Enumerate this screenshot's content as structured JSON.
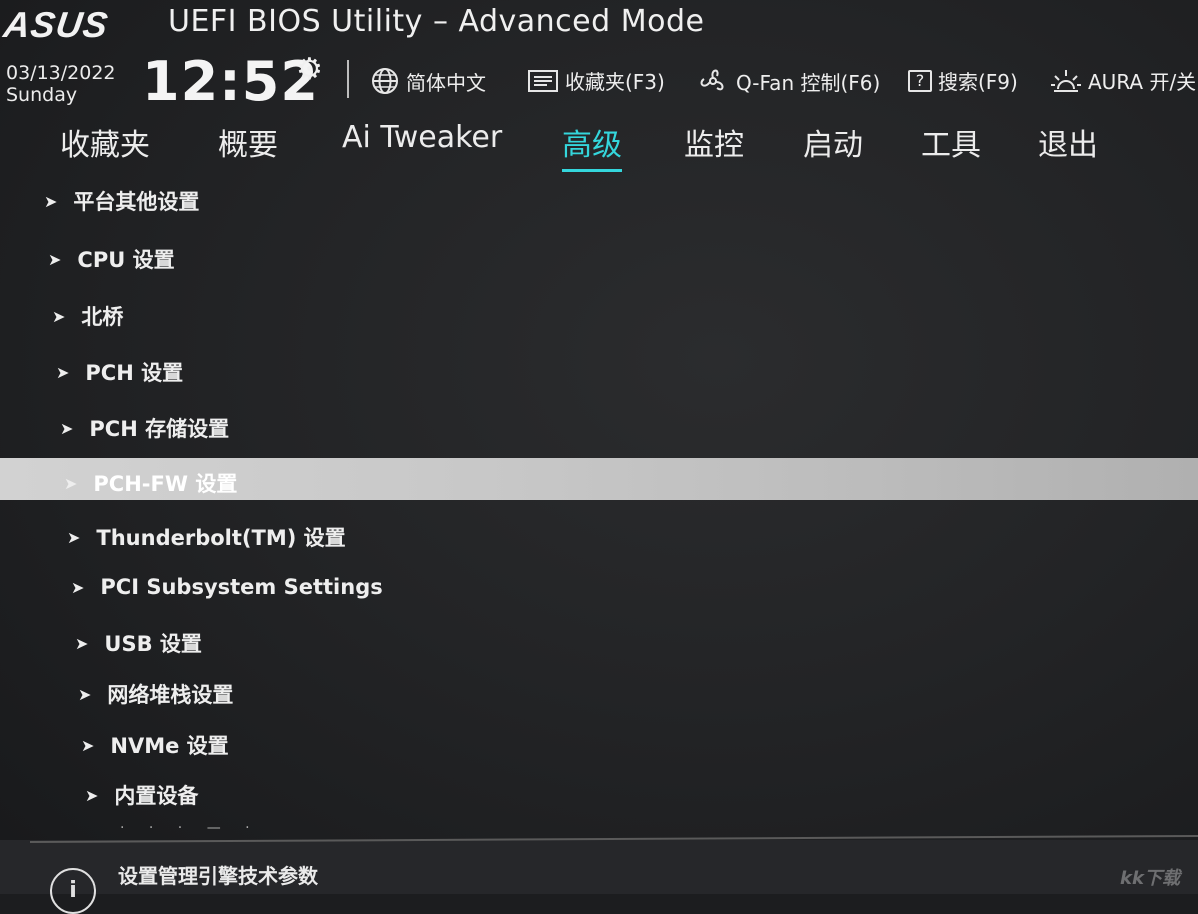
{
  "header": {
    "logo": "ASUS",
    "title": "UEFI BIOS Utility – Advanced Mode",
    "date": "03/13/2022",
    "weekday": "Sunday",
    "time": "12:52",
    "tools": {
      "language": "简体中文",
      "favorites": "收藏夹(F3)",
      "qfan": "Q-Fan 控制(F6)",
      "search": "搜索(F9)",
      "aura": "AURA 开/关"
    }
  },
  "tabs": [
    {
      "label": "收藏夹"
    },
    {
      "label": "概要"
    },
    {
      "label": "Ai Tweaker"
    },
    {
      "label": "高级",
      "active": true
    },
    {
      "label": "监控"
    },
    {
      "label": "启动"
    },
    {
      "label": "工具"
    },
    {
      "label": "退出"
    }
  ],
  "menu": [
    {
      "label": "平台其他设置"
    },
    {
      "label": "CPU 设置"
    },
    {
      "label": "北桥"
    },
    {
      "label": "PCH 设置"
    },
    {
      "label": "PCH 存储设置"
    },
    {
      "label": "PCH-FW 设置",
      "selected": true
    },
    {
      "label": "Thunderbolt(TM) 设置"
    },
    {
      "label": "PCI Subsystem Settings"
    },
    {
      "label": "USB 设置"
    },
    {
      "label": "网络堆栈设置"
    },
    {
      "label": "NVMe 设置"
    },
    {
      "label": "内置设备"
    }
  ],
  "help": {
    "icon": "i",
    "text": "设置管理引擎技术参数"
  },
  "watermark": "kk下载",
  "colors": {
    "accent": "#34d6dc",
    "background": "#1c1d1f",
    "selection": "#c8c8c8"
  }
}
